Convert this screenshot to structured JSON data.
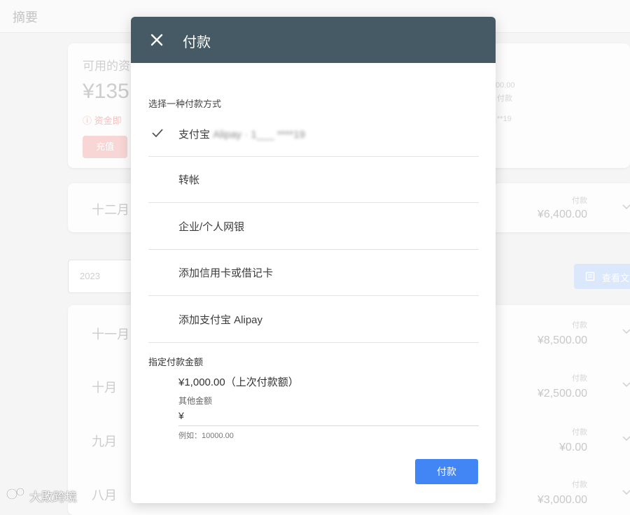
{
  "background": {
    "page_title": "摘要",
    "balance_label": "可用的资",
    "balance_amount": "¥135",
    "warning_text": "资金即",
    "recharge_label": "充值",
    "right_top_amount": "00.00",
    "right_top_label": "付款",
    "right_top_extra": "**19",
    "year_value": "2023",
    "view_button_label": "查看文",
    "months": [
      {
        "name": "十二月",
        "pay_label": "付款",
        "amount": "¥6,400.00"
      },
      {
        "name": "十一月",
        "pay_label": "付款",
        "amount": "¥8,500.00"
      },
      {
        "name": "十月",
        "pay_label": "付款",
        "amount": "¥2,500.00"
      },
      {
        "name": "九月",
        "pay_label": "付款",
        "amount": "¥0.00"
      },
      {
        "name": "八月",
        "pay_label": "付款",
        "amount": "¥3,000.00"
      }
    ]
  },
  "modal": {
    "title": "付款",
    "section_label": "选择一种付款方式",
    "options": [
      {
        "label": "支付宝",
        "blurred_suffix": "Alipay · 1___ ****19",
        "selected": true
      },
      {
        "label": "转帐",
        "selected": false
      },
      {
        "label": "企业/个人网银",
        "selected": false
      },
      {
        "label": "添加信用卡或借记卡",
        "selected": false
      },
      {
        "label": "添加支付宝 Alipay",
        "selected": false
      }
    ],
    "amount_section_label": "指定付款金额",
    "last_amount_option": "¥1,000.00（上次付款额）",
    "other_amount_label": "其他金额",
    "currency_symbol": "¥",
    "amount_value": "",
    "example_hint": "例如：10000.00",
    "pay_button_label": "付款"
  },
  "watermark": {
    "text": "大敗跨境"
  },
  "colors": {
    "header": "#455a64",
    "primary": "#4285f4"
  }
}
